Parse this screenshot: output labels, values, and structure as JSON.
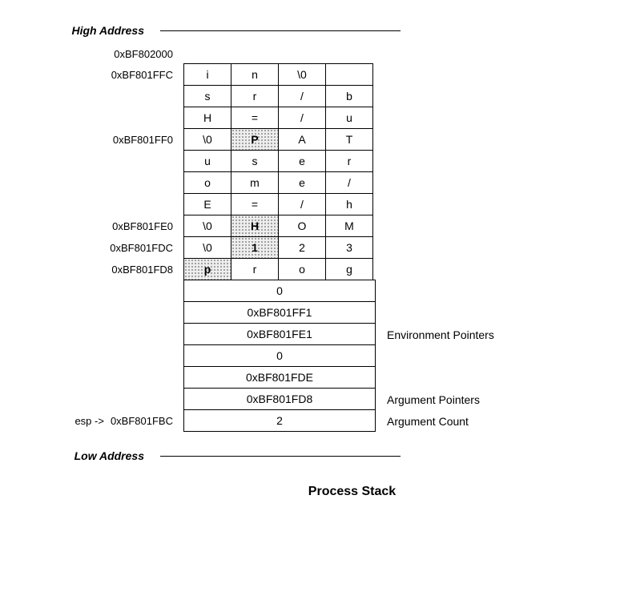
{
  "labels": {
    "high_address": "High Address",
    "low_address": "Low Address",
    "process_stack": "Process Stack",
    "esp": "esp ->",
    "env_pointers": "Environment Pointers",
    "arg_pointers": "Argument Pointers",
    "arg_count": "Argument Count"
  },
  "addresses": {
    "top": "0xBF802000",
    "r0": "0xBF801FFC",
    "r3": "0xBF801FF0",
    "r7": "0xBF801FE0",
    "r8": "0xBF801FDC",
    "r9": "0xBF801FD8",
    "bottom": "0xBF801FBC"
  },
  "chart_data": {
    "type": "table",
    "title": "Process Stack memory layout",
    "byte_rows": [
      {
        "addr": "0xBF801FFC",
        "bytes": [
          "i",
          "n",
          "\\0",
          ""
        ]
      },
      {
        "addr": "",
        "bytes": [
          "s",
          "r",
          "/",
          "b"
        ]
      },
      {
        "addr": "",
        "bytes": [
          "H",
          "=",
          "/",
          "u"
        ]
      },
      {
        "addr": "0xBF801FF0",
        "bytes": [
          "\\0",
          "P",
          "A",
          "T"
        ],
        "shaded": [
          1
        ]
      },
      {
        "addr": "",
        "bytes": [
          "u",
          "s",
          "e",
          "r"
        ]
      },
      {
        "addr": "",
        "bytes": [
          "o",
          "m",
          "e",
          "/"
        ]
      },
      {
        "addr": "",
        "bytes": [
          "E",
          "=",
          "/",
          "h"
        ]
      },
      {
        "addr": "0xBF801FE0",
        "bytes": [
          "\\0",
          "H",
          "O",
          "M"
        ],
        "shaded": [
          1
        ]
      },
      {
        "addr": "0xBF801FDC",
        "bytes": [
          "\\0",
          "1",
          "2",
          "3"
        ],
        "shaded": [
          1
        ]
      },
      {
        "addr": "0xBF801FD8",
        "bytes": [
          "p",
          "r",
          "o",
          "g"
        ],
        "shaded": [
          0
        ]
      }
    ],
    "word_rows": [
      {
        "value": "0",
        "label": ""
      },
      {
        "value": "0xBF801FF1",
        "label": ""
      },
      {
        "value": "0xBF801FE1",
        "label": "Environment Pointers"
      },
      {
        "value": "0",
        "label": ""
      },
      {
        "value": "0xBF801FDE",
        "label": ""
      },
      {
        "value": "0xBF801FD8",
        "label": "Argument Pointers"
      },
      {
        "value": "2",
        "label": "Argument Count",
        "addr": "0xBF801FBC",
        "esp": true
      }
    ]
  }
}
